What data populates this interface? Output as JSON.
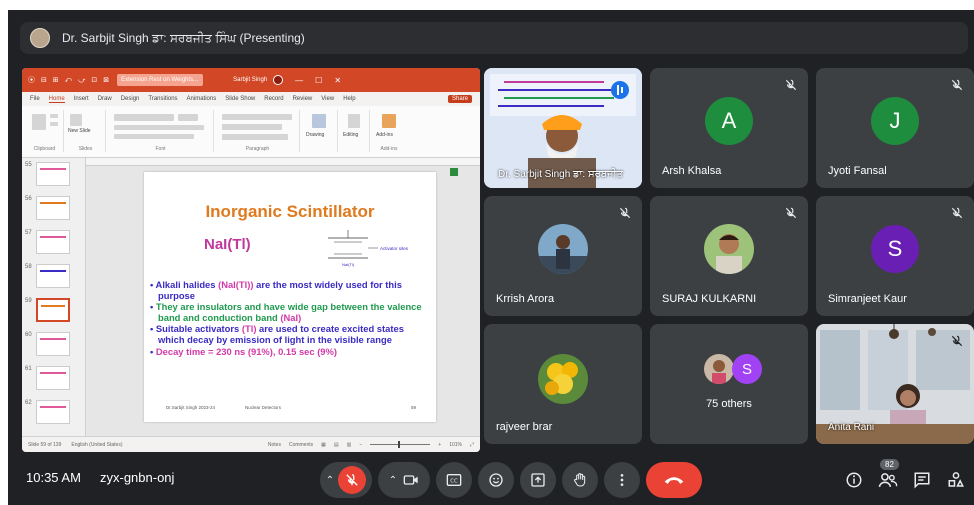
{
  "header": {
    "presenter_text": "Dr. Sarbjit Singh ਡਾ: ਸਰਬਜੀਤ ਸਿੰਘ (Presenting)"
  },
  "powerpoint": {
    "window_search": "Extension Rest on Weights...",
    "user_name": "Sarbjit Singh",
    "quick_access": "⦿ ⊟ ⊞ ⤺ ⤻ ⊡ ⊠",
    "menu": [
      "File",
      "Home",
      "Insert",
      "Draw",
      "Design",
      "Transitions",
      "Animations",
      "Slide Show",
      "Record",
      "Review",
      "View",
      "Help"
    ],
    "share_label": "Share",
    "ribbon_groups": [
      "Clipboard",
      "Slides",
      "Font",
      "Paragraph",
      "Drawing",
      "Editing",
      "Add-ins"
    ],
    "ribbon_buttons": {
      "new_slide": "New Slide",
      "drawing": "Drawing",
      "editing": "Editing",
      "addins": "Add-ins"
    },
    "slide_numbers": [
      "55",
      "56",
      "57",
      "58",
      "59",
      "60",
      "61",
      "62"
    ],
    "selected_slide": "59",
    "statusbar": {
      "slide_of": "Slide 59 of 139",
      "language": "English (United States)",
      "notes": "Notes",
      "comments": "Comments",
      "zoom": "101%"
    }
  },
  "slide": {
    "title": "Inorganic Scintillator",
    "subtitle": "NaI(Tl)",
    "diagram_label_1": "Activator sites",
    "diagram_label_2": "NaI(Tl)",
    "bullets": [
      {
        "parts": [
          {
            "text": "Alkali halides ",
            "color": "blue"
          },
          {
            "text": "(NaI(Tl))",
            "color": "pink"
          },
          {
            "text": " are the most widely used for this purpose",
            "color": "blue"
          }
        ]
      },
      {
        "parts": [
          {
            "text": "They are insulators and have wide gap between the valence band and conduction band ",
            "color": "green"
          },
          {
            "text": "(NaI)",
            "color": "pink"
          }
        ]
      },
      {
        "parts": [
          {
            "text": "Suitable activators ",
            "color": "blue"
          },
          {
            "text": "(Tl)",
            "color": "pink"
          },
          {
            "text": " are used to create excited states which decay by emission of light in the visible range",
            "color": "blue"
          }
        ]
      },
      {
        "parts": [
          {
            "text": "Decay time = 230 ns (91%), 0.15 sec (9%)",
            "color": "pink"
          }
        ]
      }
    ],
    "footer_left": "Dr.Sarbjit Singh 2023-24",
    "footer_mid": "Nuclear Detectors",
    "footer_right": "59"
  },
  "participants": [
    {
      "name": "Dr. Sarbjit Singh ਡਾ: ਸਰਬਜੀਤ",
      "type": "video"
    },
    {
      "name": "Arsh Khalsa",
      "letter": "A",
      "color": "#1e8e3e"
    },
    {
      "name": "Jyoti Fansal",
      "letter": "J",
      "color": "#1e8e3e"
    },
    {
      "name": "Krrish Arora",
      "type": "photo"
    },
    {
      "name": "SURAJ KULKARNI",
      "type": "photo"
    },
    {
      "name": "Simranjeet Kaur",
      "letter": "S",
      "color": "#6a1fb4"
    },
    {
      "name": "rajveer brar",
      "type": "photo"
    },
    {
      "name": "75 others",
      "letter": "S",
      "color": "#a142f4"
    },
    {
      "name": "Anita Rani",
      "type": "video"
    }
  ],
  "controls": {
    "time": "10:35 AM",
    "meeting_code": "zyx-gnbn-onj",
    "participant_count": "82"
  },
  "colors": {
    "background": "#202124",
    "tile": "#3c4043",
    "end_call": "#ea4335",
    "ppt_accent": "#d24726"
  },
  "icons": [
    "mic-off-icon",
    "camera-icon",
    "captions-icon",
    "emoji-icon",
    "present-icon",
    "raise-hand-icon",
    "more-options-icon",
    "end-call-icon",
    "info-icon",
    "people-icon",
    "chat-icon",
    "activities-icon"
  ]
}
